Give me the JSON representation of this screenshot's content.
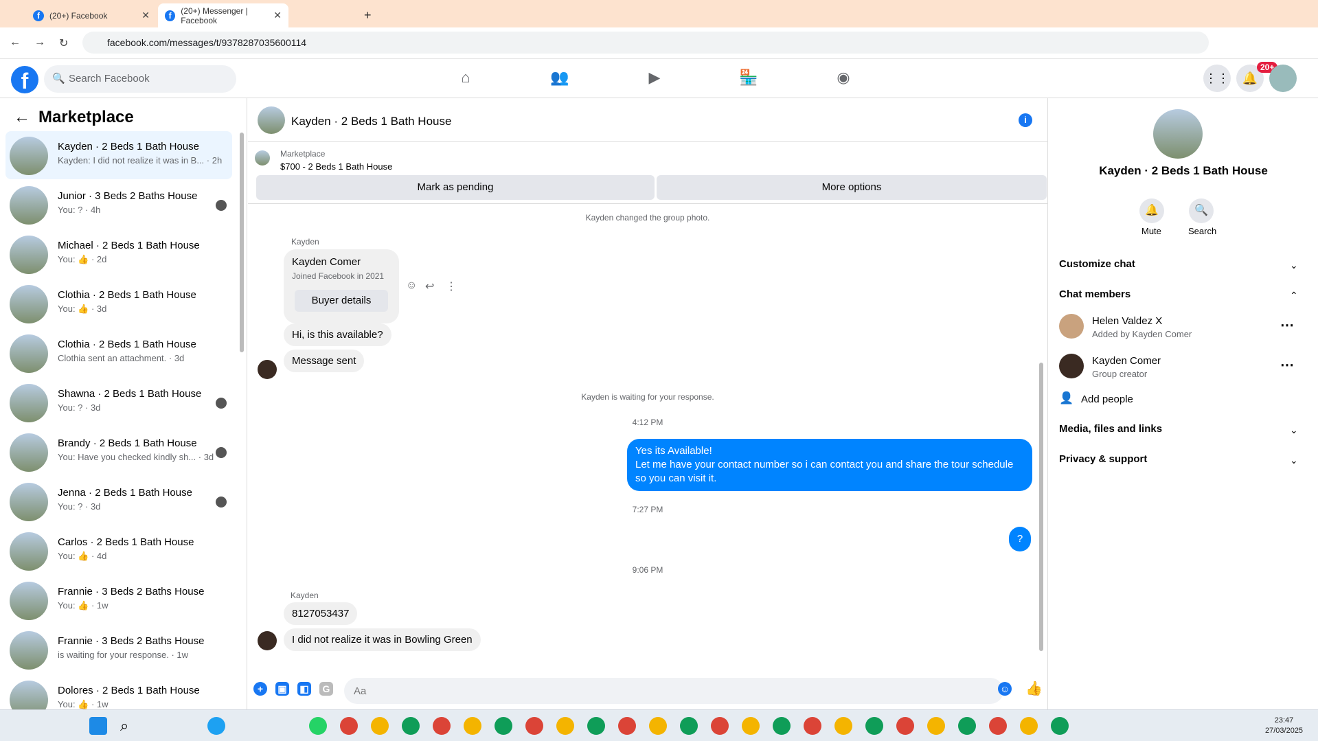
{
  "browser": {
    "tabs": [
      {
        "title": "(20+) Facebook"
      },
      {
        "title": "(20+) Messenger | Facebook"
      }
    ],
    "url": "facebook.com/messages/t/9378287035600114"
  },
  "header": {
    "search_placeholder": "Search Facebook",
    "notif_badge": "20+"
  },
  "sidebar": {
    "title": "Marketplace",
    "items": [
      {
        "name": "Kayden · 2 Beds 1 Bath House",
        "snippet": "Kayden: I did not realize it was in B... · 2h"
      },
      {
        "name": "Junior · 3 Beds 2 Baths House",
        "snippet": "You: ? · 4h"
      },
      {
        "name": "Michael · 2 Beds 1 Bath House",
        "snippet": "You: 👍 · 2d"
      },
      {
        "name": "Clothia · 2 Beds 1 Bath House",
        "snippet": "You: 👍 · 3d"
      },
      {
        "name": "Clothia · 2 Beds 1 Bath House",
        "snippet": "Clothia sent an attachment. · 3d"
      },
      {
        "name": "Shawna · 2 Beds 1 Bath House",
        "snippet": "You: ? · 3d"
      },
      {
        "name": "Brandy · 2 Beds 1 Bath House",
        "snippet": "You: Have you checked kindly sh... · 3d"
      },
      {
        "name": "Jenna · 2 Beds 1 Bath House",
        "snippet": "You: ? · 3d"
      },
      {
        "name": "Carlos · 2 Beds 1 Bath House",
        "snippet": "You: 👍 · 4d"
      },
      {
        "name": "Frannie · 3 Beds 2 Baths House",
        "snippet": "You: 👍 · 1w"
      },
      {
        "name": "Frannie · 3 Beds 2 Baths House",
        "snippet": "is waiting for your response. · 1w"
      },
      {
        "name": "Dolores · 2 Beds 1 Bath House",
        "snippet": "You: 👍 · 1w"
      }
    ]
  },
  "chat": {
    "title": "Kayden · 2 Beds 1 Bath House",
    "marketplace_label": "Marketplace",
    "listing": "$700 - 2 Beds 1 Bath House",
    "mark_pending": "Mark as pending",
    "more_options": "More options",
    "sys_photo": "Kayden changed the group photo.",
    "sender1": "Kayden",
    "card_name": "Kayden Comer",
    "card_joined": "Joined Facebook in 2021",
    "buyer_details": "Buyer details",
    "msg1": "Hi, is this available?",
    "msg2": "Message sent",
    "sys_waiting": "Kayden is waiting for your response.",
    "time1": "4:12 PM",
    "reply": "Yes its Available!\nLet me have your contact number so i can contact you and share the tour schedule so you can visit it.",
    "time2": "7:27 PM",
    "reply2": "?",
    "time3": "9:06 PM",
    "sender2": "Kayden",
    "msg3": "8127053437",
    "msg4": "I did not realize it was in Bowling Green",
    "compose_placeholder": "Aa"
  },
  "details": {
    "title": "Kayden · 2 Beds 1 Bath House",
    "mute": "Mute",
    "search": "Search",
    "customize": "Customize chat",
    "members": "Chat members",
    "member1": {
      "name": "Helen Valdez X",
      "sub": "Added by Kayden Comer"
    },
    "member2": {
      "name": "Kayden Comer",
      "sub": "Group creator"
    },
    "add_people": "Add people",
    "media": "Media, files and links",
    "privacy": "Privacy & support"
  },
  "taskbar": {
    "time": "23:47",
    "date": "27/03/2025"
  }
}
